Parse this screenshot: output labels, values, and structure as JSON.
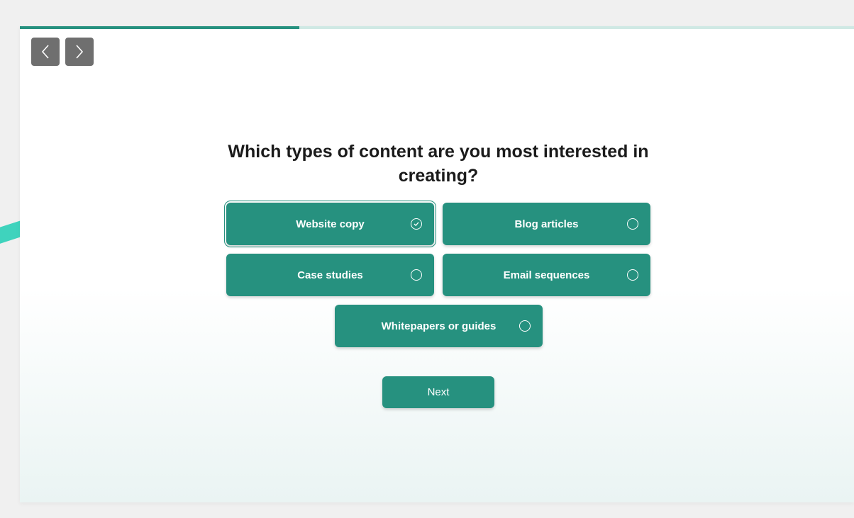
{
  "progress": {
    "fraction": 0.335
  },
  "nav": {
    "prev_icon": "chevron-left-icon",
    "next_icon": "chevron-right-icon"
  },
  "question": {
    "text": "Which types of content are you most interested in creating?"
  },
  "options": [
    {
      "label": "Website copy",
      "selected": true
    },
    {
      "label": "Blog articles",
      "selected": false
    },
    {
      "label": "Case studies",
      "selected": false
    },
    {
      "label": "Email sequences",
      "selected": false
    },
    {
      "label": "Whitepapers or guides",
      "selected": false
    }
  ],
  "next_button": {
    "label": "Next"
  },
  "colors": {
    "accent": "#26917f",
    "progress_track": "#cfe9e4",
    "nav_button": "#6f6f6f",
    "swoosh": "#3fd3bd"
  }
}
